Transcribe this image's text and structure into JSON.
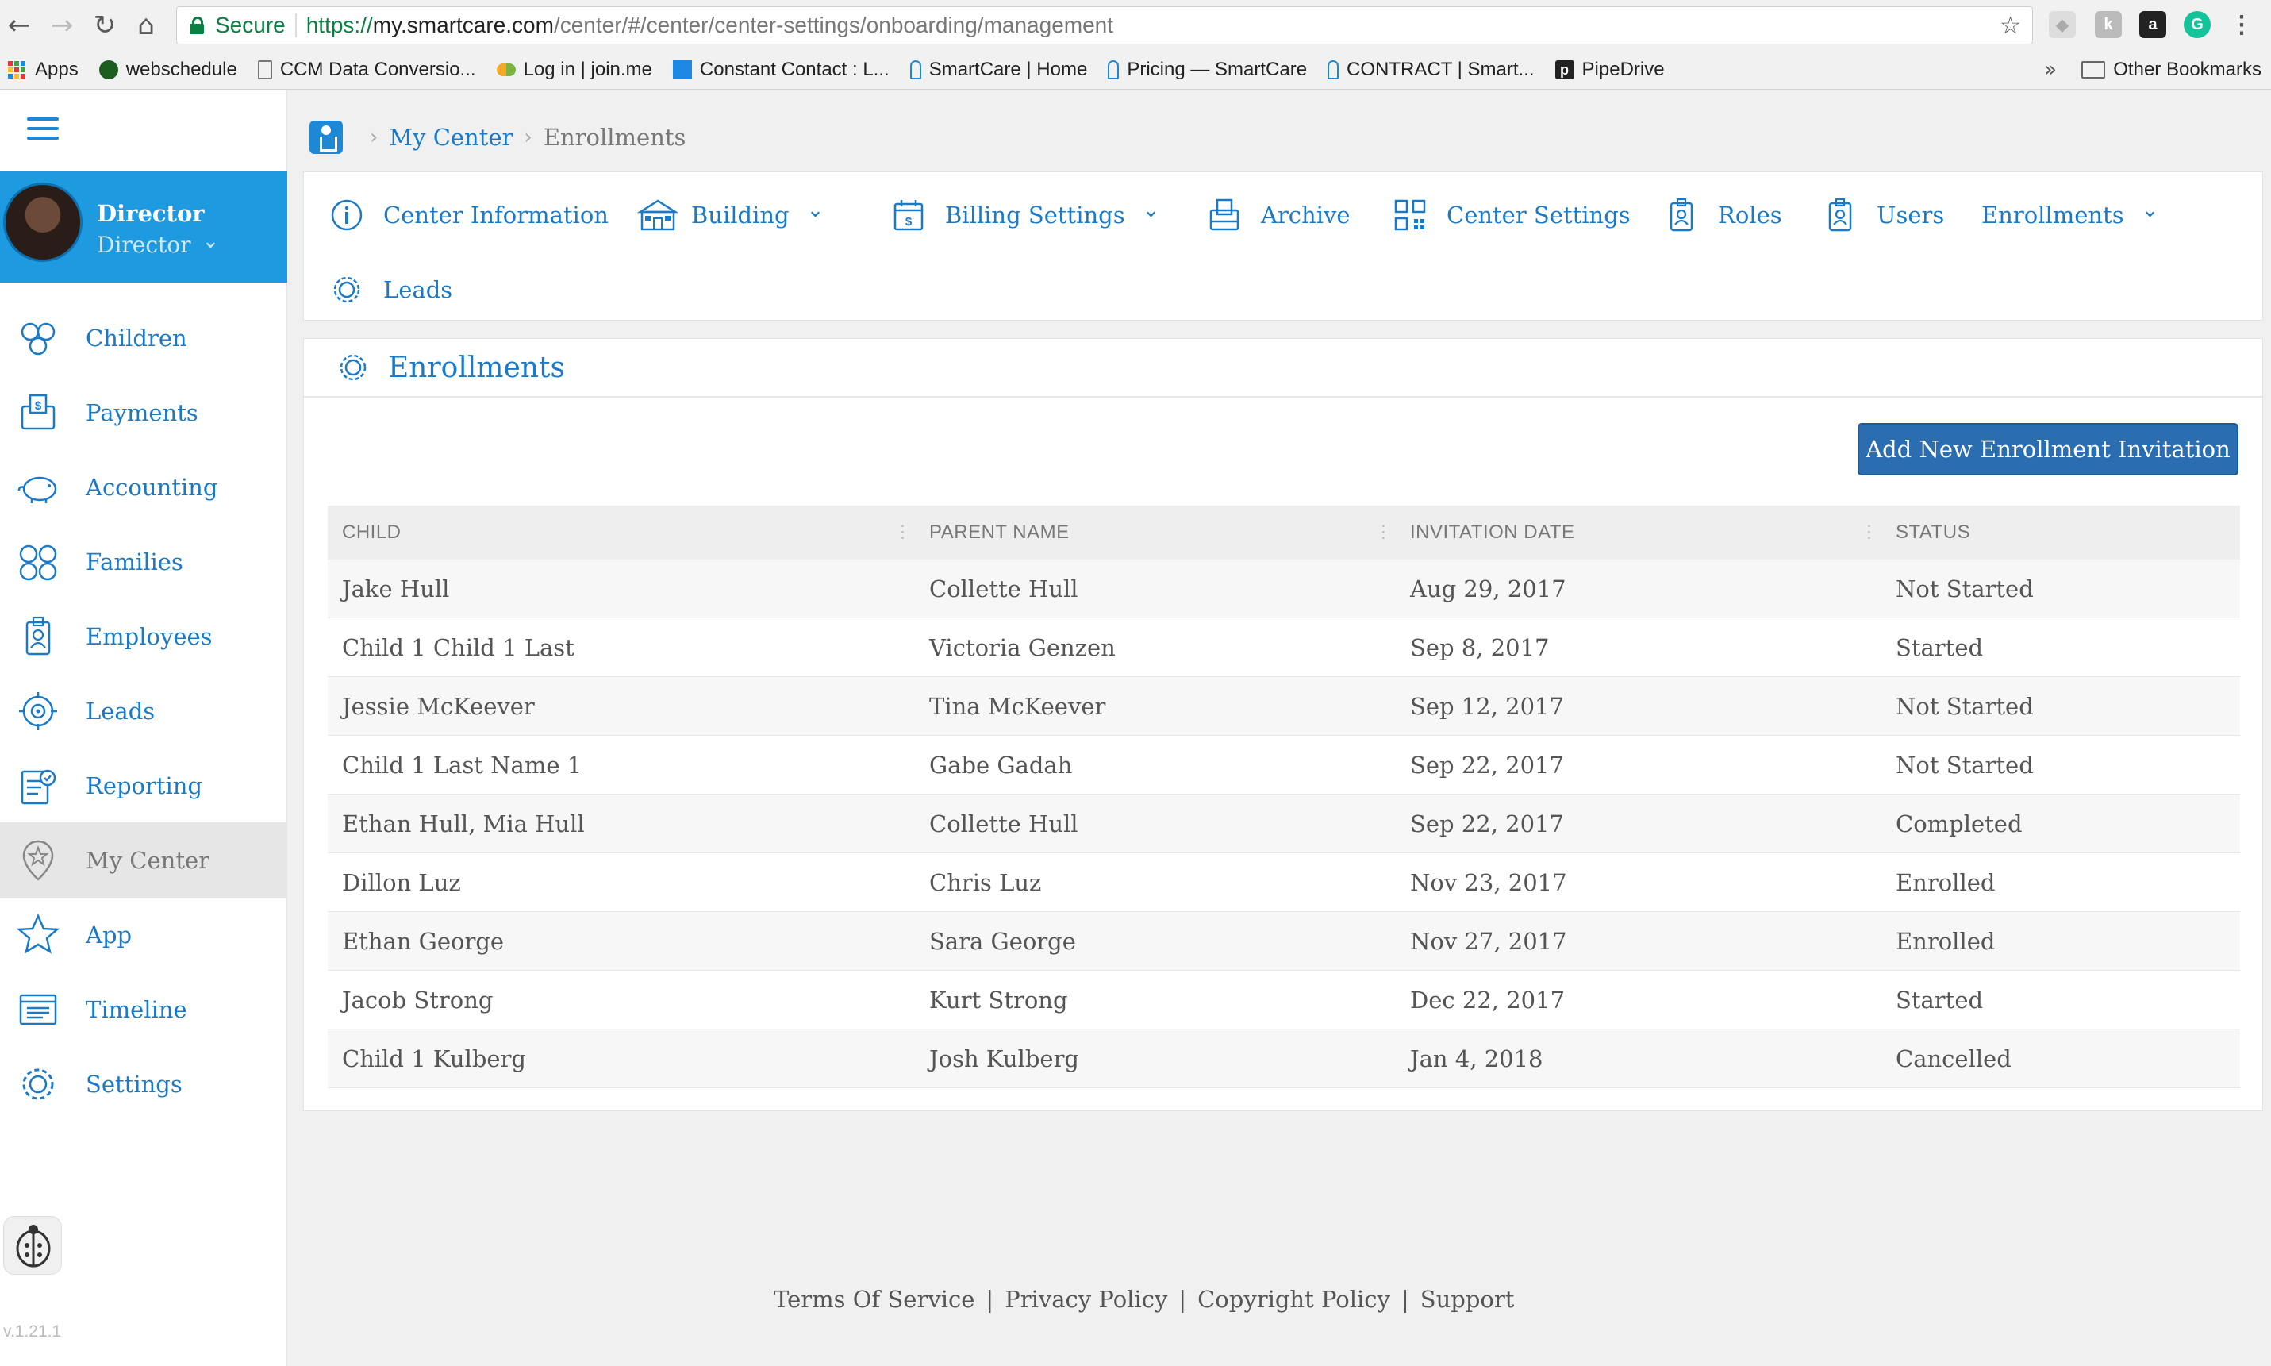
{
  "browser": {
    "secure_label": "Secure",
    "url_protocol": "https://",
    "url_host": "my.smartcare.com",
    "url_path": "/center/#/center/center-settings/onboarding/management",
    "bookmarks": [
      {
        "label": "Apps"
      },
      {
        "label": "webschedule"
      },
      {
        "label": "CCM Data Conversio..."
      },
      {
        "label": "Log in | join.me"
      },
      {
        "label": "Constant Contact : L..."
      },
      {
        "label": "SmartCare | Home"
      },
      {
        "label": "Pricing — SmartCare"
      },
      {
        "label": "CONTRACT | Smart..."
      },
      {
        "label": "PipeDrive"
      }
    ],
    "more_label": "»",
    "other_bookmarks": "Other Bookmarks"
  },
  "user": {
    "name": "Director",
    "role": "Director"
  },
  "sidebar": {
    "items": [
      {
        "label": "Children",
        "icon": "children-icon"
      },
      {
        "label": "Payments",
        "icon": "payments-icon"
      },
      {
        "label": "Accounting",
        "icon": "piggy-bank-icon"
      },
      {
        "label": "Families",
        "icon": "families-icon"
      },
      {
        "label": "Employees",
        "icon": "employee-badge-icon"
      },
      {
        "label": "Leads",
        "icon": "target-icon"
      },
      {
        "label": "Reporting",
        "icon": "report-icon"
      },
      {
        "label": "My Center",
        "icon": "center-star-icon",
        "active": true
      },
      {
        "label": "App",
        "icon": "star-icon"
      },
      {
        "label": "Timeline",
        "icon": "timeline-icon"
      },
      {
        "label": "Settings",
        "icon": "gear-icon"
      }
    ],
    "version": "v.1.21.1"
  },
  "breadcrumb": {
    "link": "My Center",
    "current": "Enrollments"
  },
  "settings_nav": [
    {
      "label": "Center Information",
      "icon": "info-icon"
    },
    {
      "label": "Building",
      "icon": "building-icon",
      "dropdown": true
    },
    {
      "label": "Billing Settings",
      "icon": "billing-calendar-icon",
      "dropdown": true
    },
    {
      "label": "Archive",
      "icon": "archive-icon"
    },
    {
      "label": "Center Settings",
      "icon": "qr-icon"
    },
    {
      "label": "Roles",
      "icon": "badge-icon"
    },
    {
      "label": "Users",
      "icon": "badge-icon"
    },
    {
      "label": "Enrollments",
      "icon": "",
      "dropdown": true
    },
    {
      "label": "Leads",
      "icon": "gear-icon"
    }
  ],
  "enrollments": {
    "title": "Enrollments",
    "add_button": "Add New Enrollment Invitation",
    "columns": [
      "CHILD",
      "PARENT NAME",
      "INVITATION DATE",
      "STATUS"
    ],
    "rows": [
      [
        "Jake Hull",
        "Collette Hull",
        "Aug 29, 2017",
        "Not Started"
      ],
      [
        "Child 1 Child 1 Last",
        "Victoria Genzen",
        "Sep 8, 2017",
        "Started"
      ],
      [
        "Jessie McKeever",
        "Tina McKeever",
        "Sep 12, 2017",
        "Not Started"
      ],
      [
        "Child 1 Last Name 1",
        "Gabe Gadah",
        "Sep 22, 2017",
        "Not Started"
      ],
      [
        "Ethan Hull, Mia Hull",
        "Collette Hull",
        "Sep 22, 2017",
        "Completed"
      ],
      [
        "Dillon Luz",
        "Chris Luz",
        "Nov 23, 2017",
        "Enrolled"
      ],
      [
        "Ethan George",
        "Sara George",
        "Nov 27, 2017",
        "Enrolled"
      ],
      [
        "Jacob Strong",
        "Kurt Strong",
        "Dec 22, 2017",
        "Started"
      ],
      [
        "Child 1 Kulberg",
        "Josh Kulberg",
        "Jan 4, 2018",
        "Cancelled"
      ]
    ]
  },
  "footer": {
    "links": [
      "Terms Of Service",
      "Privacy Policy",
      "Copyright Policy",
      "Support"
    ],
    "separator": "|"
  },
  "colors": {
    "accent": "#1b7ac8",
    "profile_bg": "#1d9ae0",
    "button_bg": "#2a6db0"
  }
}
